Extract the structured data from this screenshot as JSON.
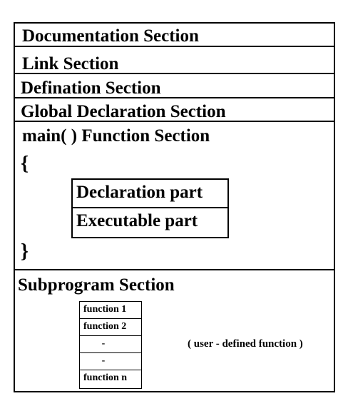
{
  "sections": {
    "documentation": "Documentation Section",
    "link": "Link Section",
    "definition": "Defination Section",
    "global": "Global Declaration Section",
    "main_function": "main( ) Function Section",
    "open_brace": "{",
    "close_brace": "}",
    "subprogram": "Subprogram Section"
  },
  "main_parts": {
    "declaration": "Declaration part",
    "executable": "Executable part"
  },
  "functions": [
    "function 1",
    "function 2",
    "-",
    "-",
    "function n"
  ],
  "user_defined_note": "( user - defined function )"
}
